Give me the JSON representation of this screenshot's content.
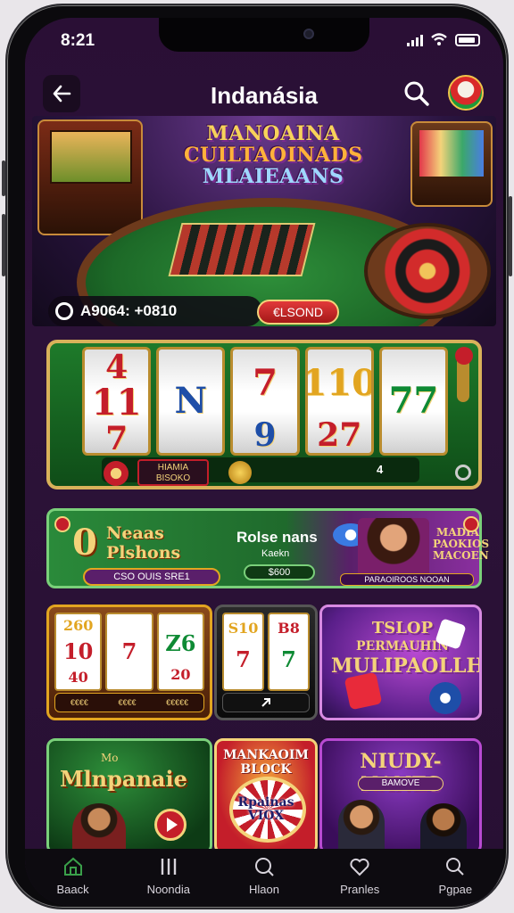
{
  "status_bar": {
    "time": "8:21"
  },
  "app_bar": {
    "title": "Indanásia"
  },
  "hero": {
    "headline_line1": "MANOAINA",
    "headline_line2": "CUILTAOINADS",
    "headline_line3": "MLAIEAANS",
    "balance": "A9064: +0810",
    "button_label": "€LSOND"
  },
  "slot_machine": {
    "reels": [
      [
        "4",
        "11",
        "7"
      ],
      [
        "",
        "N",
        ""
      ],
      [
        "",
        "7",
        "9"
      ],
      [
        "",
        "110",
        "27"
      ],
      [
        "",
        "77",
        ""
      ]
    ],
    "label_line1": "HIAMIA",
    "label_line2": "BISOKO",
    "count": "4"
  },
  "promo": {
    "big_number": "0",
    "title_line1": "Neaas",
    "title_line2": "Plshons",
    "pill_text": "CSO OUIS SRE1",
    "title2": "Rolse nans",
    "sub2": "Kaekn",
    "button2": "$600",
    "title3_line1": "MADIA",
    "title3_line2": "PAOKIOS",
    "title3_line3": "MACOEN",
    "strip_text": "PARAOIROOS NOOAN"
  },
  "tiles": {
    "slot1": {
      "reels": [
        [
          "260",
          "10",
          "40"
        ],
        [
          "",
          "7",
          ""
        ],
        [
          "",
          "Z6",
          "20"
        ]
      ],
      "footer": [
        "€€€€",
        "€€€€",
        "€€€€€"
      ]
    },
    "slot2": {
      "reels": [
        [
          "S10",
          "7",
          ""
        ],
        [
          "B8",
          "7",
          ""
        ]
      ]
    },
    "dice": {
      "line1": "TSLOP",
      "line2": "PERMAUHIN",
      "line3": "MULIPAOLLHEN"
    },
    "game1": {
      "small": "Mo",
      "title": "Mlnpanaie"
    },
    "game2": {
      "title_line1": "MANKAOIM",
      "title_line2": "BLOCK",
      "center": "Rpainas VIOX"
    },
    "game3": {
      "title": "NIUDY-NANES",
      "sub": "BAMOVE"
    }
  },
  "tabbar": {
    "items": [
      {
        "label": "Baack"
      },
      {
        "label": "Noondia"
      },
      {
        "label": "Hlaon"
      },
      {
        "label": "Pranles"
      },
      {
        "label": "Pgpae"
      }
    ]
  },
  "colors": {
    "background": "#2a0f35",
    "accent_gold": "#f4d37a",
    "accent_green": "#3aa04a",
    "accent_red": "#c41e2a"
  }
}
